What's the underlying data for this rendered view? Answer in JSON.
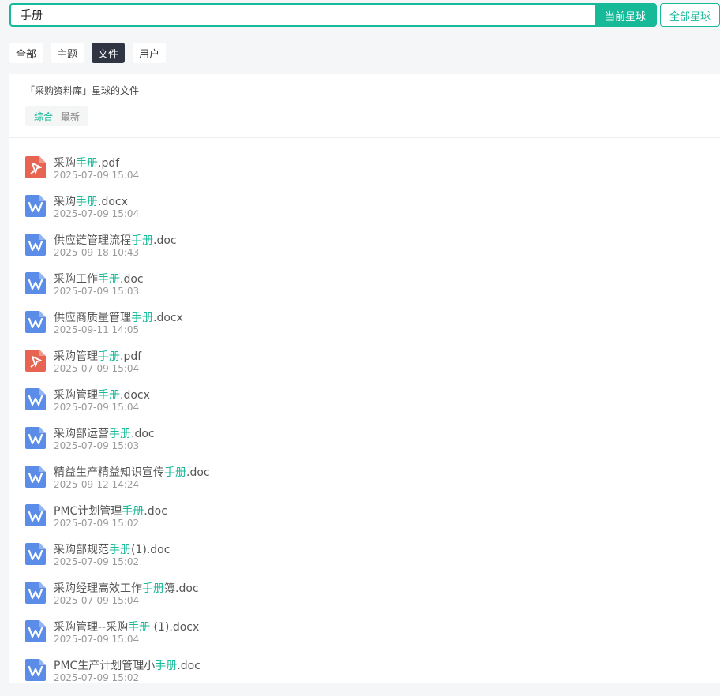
{
  "search": {
    "value": "手册",
    "current_btn": "当前星球",
    "all_btn": "全部星球"
  },
  "tabs": [
    {
      "label": "全部",
      "active": false
    },
    {
      "label": "主题",
      "active": false
    },
    {
      "label": "文件",
      "active": true
    },
    {
      "label": "用户",
      "active": false
    }
  ],
  "panel": {
    "title": "「采购资料库」星球的文件",
    "sort": [
      {
        "label": "综合",
        "active": true
      },
      {
        "label": "最新",
        "active": false
      }
    ]
  },
  "colors": {
    "accent": "#16b998",
    "pdf": "#e86452",
    "word": "#5b8de8",
    "tab_active": "#2f3542"
  },
  "files": [
    {
      "type": "pdf",
      "icon": "pdf-icon",
      "pre": "采购",
      "hl": "手册",
      "post": ".pdf",
      "date": "2025-07-09 15:04"
    },
    {
      "type": "word",
      "icon": "word-icon",
      "pre": "采购",
      "hl": "手册",
      "post": ".docx",
      "date": "2025-07-09 15:04"
    },
    {
      "type": "word",
      "icon": "word-icon",
      "pre": "供应链管理流程",
      "hl": "手册",
      "post": ".doc",
      "date": "2025-09-18 10:43"
    },
    {
      "type": "word",
      "icon": "word-icon",
      "pre": "采购工作",
      "hl": "手册",
      "post": ".doc",
      "date": "2025-07-09 15:03"
    },
    {
      "type": "word",
      "icon": "word-icon",
      "pre": "供应商质量管理",
      "hl": "手册",
      "post": ".docx",
      "date": "2025-09-11 14:05"
    },
    {
      "type": "pdf",
      "icon": "pdf-icon",
      "pre": "采购管理",
      "hl": "手册",
      "post": ".pdf",
      "date": "2025-07-09 15:04"
    },
    {
      "type": "word",
      "icon": "word-icon",
      "pre": "采购管理",
      "hl": "手册",
      "post": ".docx",
      "date": "2025-07-09 15:04"
    },
    {
      "type": "word",
      "icon": "word-icon",
      "pre": "采购部运营",
      "hl": "手册",
      "post": ".doc",
      "date": "2025-07-09 15:03"
    },
    {
      "type": "word",
      "icon": "word-icon",
      "pre": "精益生产精益知识宣传",
      "hl": "手册",
      "post": ".doc",
      "date": "2025-09-12 14:24"
    },
    {
      "type": "word",
      "icon": "word-icon",
      "pre": "PMC计划管理",
      "hl": "手册",
      "post": ".doc",
      "date": "2025-07-09 15:02"
    },
    {
      "type": "word",
      "icon": "word-icon",
      "pre": "采购部规范",
      "hl": "手册",
      "post": "(1).doc",
      "date": "2025-07-09 15:02"
    },
    {
      "type": "word",
      "icon": "word-icon",
      "pre": "采购经理高效工作",
      "hl": "手册",
      "post": "簿.doc",
      "date": "2025-07-09 15:04"
    },
    {
      "type": "word",
      "icon": "word-icon",
      "pre": "采购管理--采购",
      "hl": "手册",
      "post": " (1).docx",
      "date": "2025-07-09 15:04"
    },
    {
      "type": "word",
      "icon": "word-icon",
      "pre": "PMC生产计划管理小",
      "hl": "手册",
      "post": ".doc",
      "date": "2025-07-09 15:02"
    }
  ]
}
